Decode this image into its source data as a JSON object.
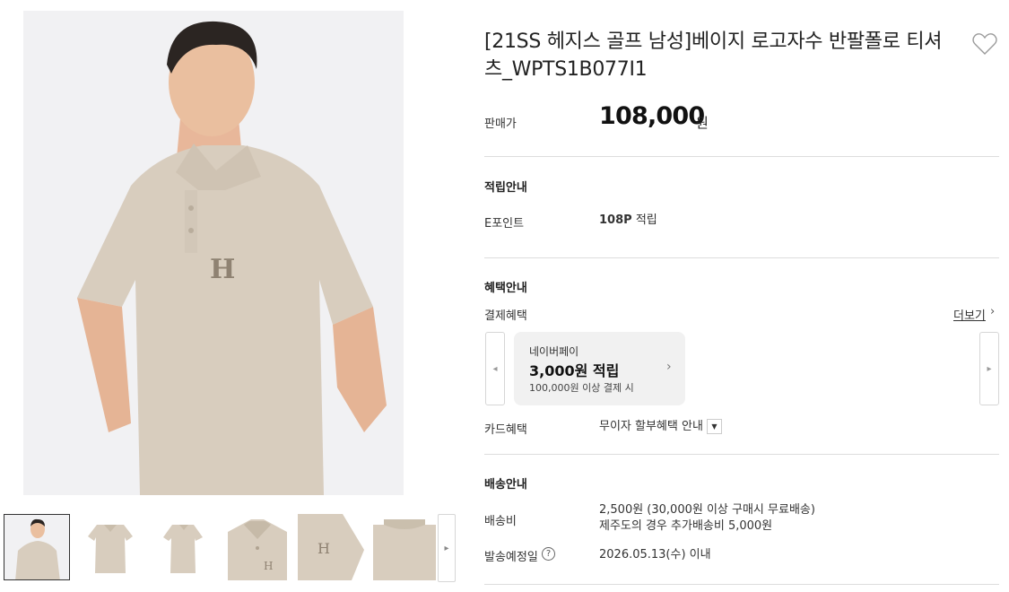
{
  "product": {
    "title": "[21SS 헤지스 골프 남성]베이지 로고자수 반팔폴로 티셔츠_WPTS1B077I1",
    "price_label": "판매가",
    "price": "108,000",
    "price_unit": "원"
  },
  "gallery": {
    "thumbnails": [
      {
        "name": "model-front",
        "active": true
      },
      {
        "name": "shirt-front",
        "active": false
      },
      {
        "name": "shirt-side",
        "active": false
      },
      {
        "name": "collar-detail",
        "active": false
      },
      {
        "name": "sleeve-detail",
        "active": false
      },
      {
        "name": "back-detail",
        "active": false
      }
    ],
    "next_icon": "chevron-right-icon"
  },
  "points": {
    "section_title": "적립안내",
    "label": "E포인트",
    "value": "108P",
    "value_suffix": "적립"
  },
  "benefits": {
    "section_title": "혜택안내",
    "payment_label": "결제혜택",
    "more_label": "더보기",
    "card": {
      "name": "네이버페이",
      "amount": "3,000원 적립",
      "condition": "100,000원 이상 결제 시"
    },
    "card_benefit_label": "카드혜택",
    "card_benefit_value": "무이자 할부혜택 안내"
  },
  "shipping": {
    "section_title": "배송안내",
    "fee_label": "배송비",
    "fee_line1": "2,500원 (30,000원 이상 구매시 무료배송)",
    "fee_line2": "제주도의 경우 추가배송비 5,000원",
    "date_label": "발송예정일",
    "date_value": "2026.05.13(수) 이내"
  },
  "colors": {
    "shirt": "#d8cdbe",
    "background": "#f1f1f3",
    "divider": "#dddddd"
  }
}
